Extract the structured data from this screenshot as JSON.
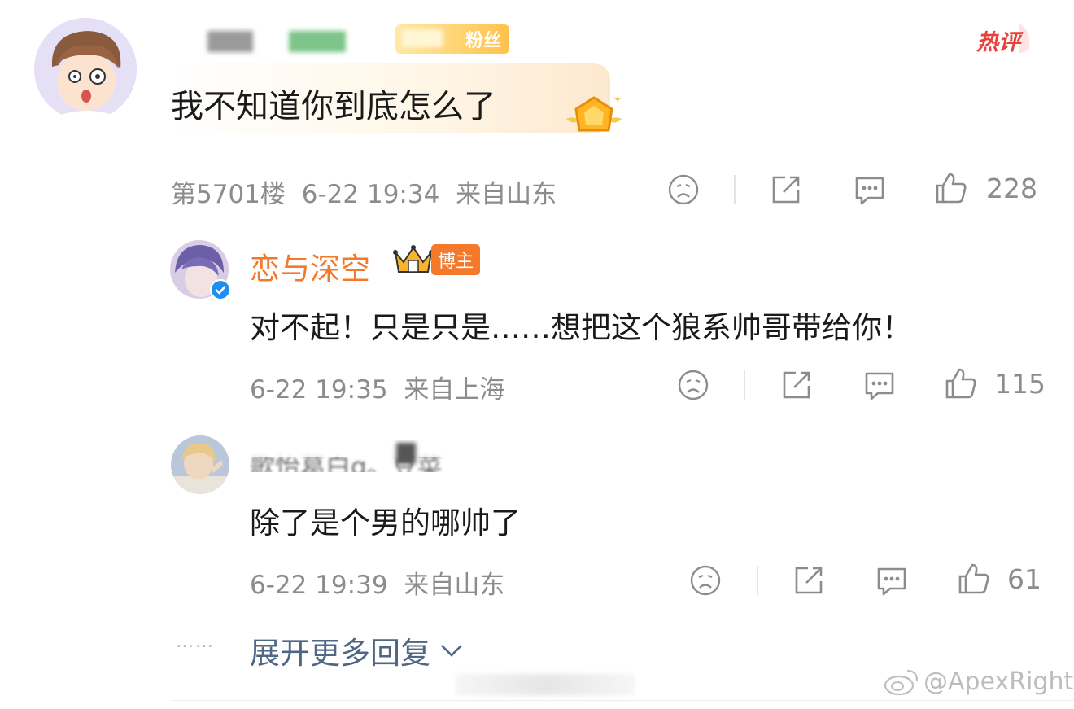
{
  "hot_badge": "热评",
  "main_comment": {
    "fan_badge_text": "粉丝",
    "text": "我不知道你到底怎么了",
    "floor": "第5701楼",
    "time": "6-22 19:34",
    "location": "来自山东",
    "likes": "228"
  },
  "replies": [
    {
      "username": "恋与深空",
      "role_badge": "博主",
      "text": "对不起！只是只是……想把这个狼系帅哥带给你！",
      "time": "6-22 19:35",
      "location": "来自上海",
      "likes": "115"
    },
    {
      "username": "歌怡葛白g。豆菜",
      "text": "除了是个男的哪帅了",
      "time": "6-22 19:39",
      "location": "来自山东",
      "likes": "61"
    }
  ],
  "expand_label": "展开更多回复",
  "dots": "……",
  "watermark": "@ApexRight",
  "colors": {
    "accent_orange": "#f5792a",
    "hot_red": "#e8403a",
    "link_blue": "#4f6785",
    "meta_gray": "#8c8c8c"
  }
}
